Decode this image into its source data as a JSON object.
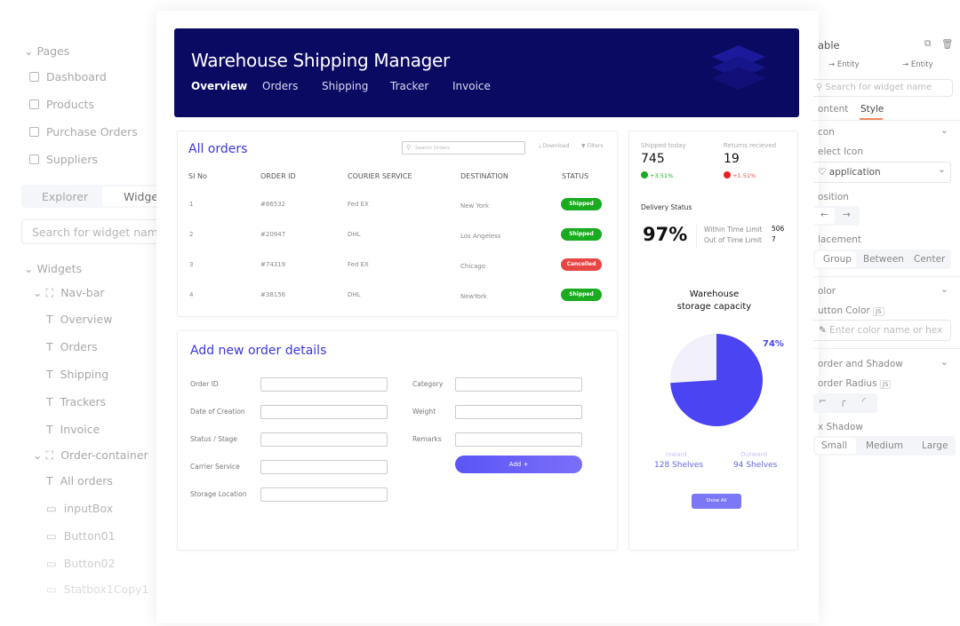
{
  "left_panel": {
    "pages_header": "Pages",
    "pages": [
      "Dashboard",
      "Products",
      "Purchase Orders",
      "Suppliers"
    ],
    "tabs": [
      "Explorer",
      "Widge"
    ],
    "search_placeholder": "Search for widget name",
    "widgets_header": "Widgets",
    "tree": [
      {
        "label": "Nav-bar",
        "type": "container"
      },
      {
        "label": "Overview",
        "type": "text"
      },
      {
        "label": "Orders",
        "type": "text"
      },
      {
        "label": "Shipping",
        "type": "text"
      },
      {
        "label": "Trackers",
        "type": "text"
      },
      {
        "label": "Invoice",
        "type": "text"
      },
      {
        "label": "Order-container",
        "type": "container"
      },
      {
        "label": "All orders",
        "type": "text"
      },
      {
        "label": "inputBox",
        "type": "input"
      },
      {
        "label": "Button01",
        "type": "button"
      },
      {
        "label": "Button02",
        "type": "button"
      },
      {
        "label": "Statbox1Copy1",
        "type": "button"
      }
    ]
  },
  "header": {
    "title": "Warehouse Shipping Manager",
    "nav": [
      "Overview",
      "Orders",
      "Shipping",
      "Tracker",
      "Invoice"
    ],
    "active": "Overview",
    "bg": "#0b0a63"
  },
  "orders": {
    "title": "All orders",
    "search_placeholder": "Search Orders",
    "download": "Download",
    "filters": "Filters",
    "columns": [
      "SI No",
      "ORDER ID",
      "COURIER SERVICE",
      "DESTINATION",
      "STATUS"
    ],
    "rows": [
      [
        "1",
        "#86532",
        "Fed EX",
        "New York",
        "Shipped"
      ],
      [
        "2",
        "#20947",
        "DHL",
        "Los Angeless",
        "Shipped"
      ],
      [
        "3",
        "#74319",
        "Fed EX",
        "Chicago",
        "Cancelled"
      ],
      [
        "4",
        "#38156",
        "DHL",
        "NewYork",
        "Shipped"
      ]
    ],
    "status_colors": {
      "Shipped": "#1aab1f",
      "Cancelled": "#e84545"
    }
  },
  "form": {
    "title": "Add new order details",
    "left_fields": [
      "Order ID",
      "Date of Creation",
      "Status / Stage",
      "Carrier Service",
      "Storage Location"
    ],
    "right_fields": [
      "Category",
      "Weight",
      "Remarks"
    ],
    "add_button": "Add +"
  },
  "stats": {
    "shipped_label": "Shipped today",
    "shipped_value": "745",
    "shipped_change": "+3.51%",
    "returns_label": "Returns recieved",
    "returns_value": "19",
    "returns_change": "+1.51%",
    "delivery_title": "Delivery Status",
    "delivery_pct": "97%",
    "within_label": "Within Time Limit",
    "within_value": "506",
    "out_label": "Out of Time Limit",
    "out_value": "7",
    "capacity_title_1": "Warehouse",
    "capacity_title_2": "storage capacity",
    "capacity_pct": "74%",
    "capacity_fraction": 0.74,
    "inward_label": "Inward",
    "inward_value": "128 Shelves",
    "outward_label": "Outward",
    "outward_value": "94 Shelves",
    "show_all": "Show All",
    "accent": "#4a44f2"
  },
  "right_panel": {
    "title": "able",
    "entity_1": "→ Entity",
    "entity_2": "→ Entity",
    "search_placeholder": "Search for widget name",
    "tabs": [
      "ontent",
      "Style"
    ],
    "active_tab": "Style",
    "icon_section": "con",
    "select_icon_label": "elect Icon",
    "select_icon_value": "application",
    "position_label": "osition",
    "placement_label": "lacement",
    "placement_options": [
      "Group",
      "Between",
      "Center"
    ],
    "color_section": "olor",
    "button_color_label": "utton Color",
    "js": "JS",
    "color_placeholder": "Enter color name or hex",
    "border_section": "order and Shadow",
    "border_radius_label": "order Radius",
    "box_shadow_label": "x Shadow",
    "shadow_options": [
      "Small",
      "Medium",
      "Large"
    ]
  }
}
